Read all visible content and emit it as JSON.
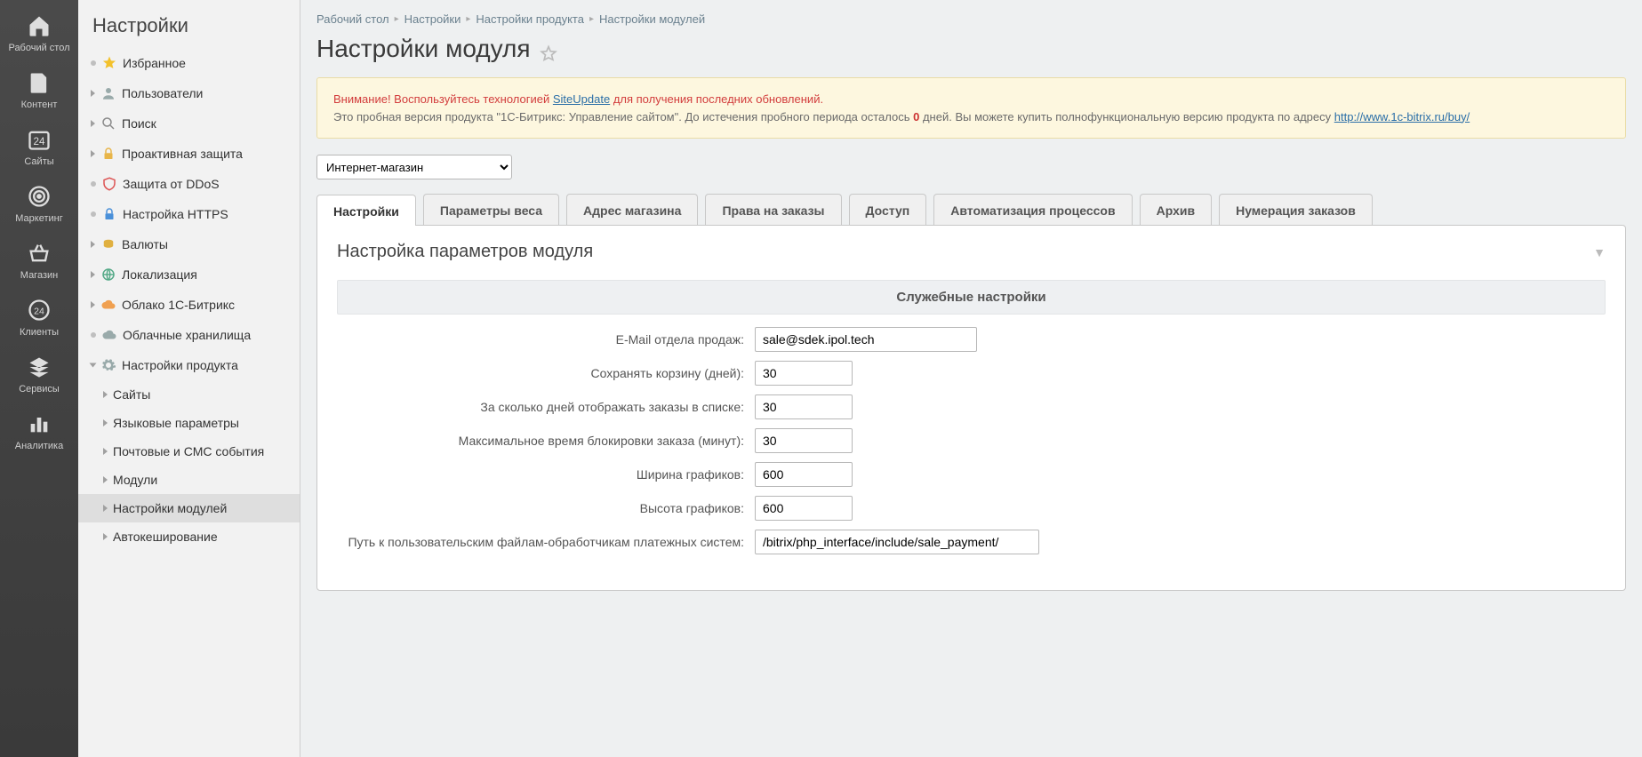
{
  "rail": [
    {
      "id": "desktop",
      "label": "Рабочий стол"
    },
    {
      "id": "content",
      "label": "Контент"
    },
    {
      "id": "sites",
      "label": "Сайты"
    },
    {
      "id": "marketing",
      "label": "Маркетинг"
    },
    {
      "id": "shop",
      "label": "Магазин"
    },
    {
      "id": "clients",
      "label": "Клиенты"
    },
    {
      "id": "services",
      "label": "Сервисы"
    },
    {
      "id": "analytics",
      "label": "Аналитика"
    }
  ],
  "sidebar_title": "Настройки",
  "tree": {
    "favorites": "Избранное",
    "users": "Пользователи",
    "search": "Поиск",
    "proactive": "Проактивная защита",
    "ddos": "Защита от DDoS",
    "https": "Настройка HTTPS",
    "currency": "Валюты",
    "locale": "Локализация",
    "cloud": "Облако 1С-Битрикс",
    "cloudstore": "Облачные хранилища",
    "product": "Настройки продукта",
    "product_sites": "Сайты",
    "product_lang": "Языковые параметры",
    "product_mail": "Почтовые и СМС события",
    "product_modules": "Модули",
    "product_modset": "Настройки модулей",
    "product_autocache": "Автокеширование"
  },
  "breadcrumbs": [
    "Рабочий стол",
    "Настройки",
    "Настройки продукта",
    "Настройки модулей"
  ],
  "page_title": "Настройки модуля",
  "notice": {
    "warn": "Внимание! Воспользуйтесь технологией ",
    "link1_text": "SiteUpdate",
    "warn_tail": " для получения последних обновлений.",
    "line2a": "Это пробная версия продукта \"1С-Битрикс: Управление сайтом\". До истечения пробного периода осталось ",
    "zero": "0",
    "line2b": " дней. Вы можете купить полнофункциональную версию продукта по адресу ",
    "link2_text": "http://www.1c-bitrix.ru/buy/"
  },
  "module_selected": "Интернет-магазин",
  "tabs": [
    "Настройки",
    "Параметры веса",
    "Адрес магазина",
    "Права на заказы",
    "Доступ",
    "Автоматизация процессов",
    "Архив",
    "Нумерация заказов"
  ],
  "panel_title": "Настройка параметров модуля",
  "section_header": "Служебные настройки",
  "fields": {
    "email": {
      "label": "E-Mail отдела продаж:",
      "value": "sale@sdek.ipol.tech"
    },
    "basket_days": {
      "label": "Сохранять корзину (дней):",
      "value": "30"
    },
    "order_list_days": {
      "label": "За сколько дней отображать заказы в списке:",
      "value": "30"
    },
    "lock_min": {
      "label": "Максимальное время блокировки заказа (минут):",
      "value": "30"
    },
    "chart_w": {
      "label": "Ширина графиков:",
      "value": "600"
    },
    "chart_h": {
      "label": "Высота графиков:",
      "value": "600"
    },
    "pay_path": {
      "label": "Путь к пользовательским файлам-обработчикам платежных систем:",
      "value": "/bitrix/php_interface/include/sale_payment/"
    }
  }
}
